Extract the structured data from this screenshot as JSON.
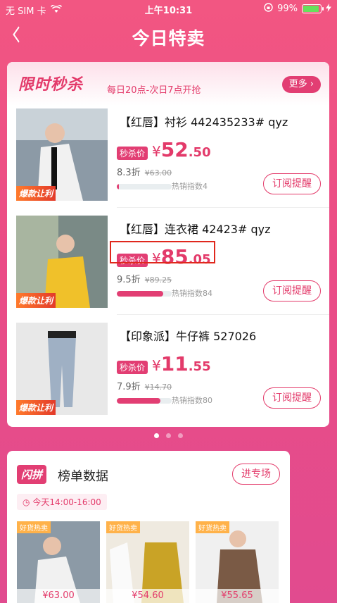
{
  "status_bar": {
    "carrier": "无 SIM 卡",
    "time": "上午10:31",
    "battery": "99%",
    "battery_level": 0.99
  },
  "nav": {
    "title": "今日特卖",
    "back_icon": "back-chevron-icon"
  },
  "flash_sale": {
    "brand": "限时秒杀",
    "subtitle": "每日20点-次日7点开抢",
    "more_label": "更多",
    "items": [
      {
        "tag": "爆款让利",
        "name": "【红唇】衬衫 442435233# qyz",
        "label": "秒杀价",
        "currency": "¥",
        "price_int": "52",
        "price_dec": ".50",
        "discount": "8.3折",
        "original": "¥63.00",
        "hot_text": "热销指数4",
        "hot_value": 0.04,
        "button": "订阅提醒"
      },
      {
        "tag": "爆款让利",
        "name": "【红唇】连衣裙 42423# qyz",
        "label": "秒杀价",
        "currency": "¥",
        "price_int": "85",
        "price_dec": ".05",
        "discount": "9.5折",
        "original": "¥89.25",
        "hot_text": "热销指数84",
        "hot_value": 0.84,
        "button": "订阅提醒"
      },
      {
        "tag": "爆款让利",
        "name": "【印象派】牛仔裤 527026",
        "label": "秒杀价",
        "currency": "¥",
        "price_int": "11",
        "price_dec": ".55",
        "discount": "7.9折",
        "original": "¥14.70",
        "hot_text": "热销指数80",
        "hot_value": 0.8,
        "button": "订阅提醒"
      }
    ]
  },
  "group_buy": {
    "badge": "闪拼",
    "title": "榜单数据",
    "enter_label": "进专场",
    "time": "今天14:00-16:00",
    "products": [
      {
        "tag": "好货热卖",
        "price": "¥63.00"
      },
      {
        "tag": "好货热卖",
        "price": "¥54.60"
      },
      {
        "tag": "好货热卖",
        "price": "¥55.65"
      }
    ]
  },
  "colors": {
    "accent": "#e33a6a",
    "bg": "#ea4c86",
    "highlight": "#e0281d"
  }
}
